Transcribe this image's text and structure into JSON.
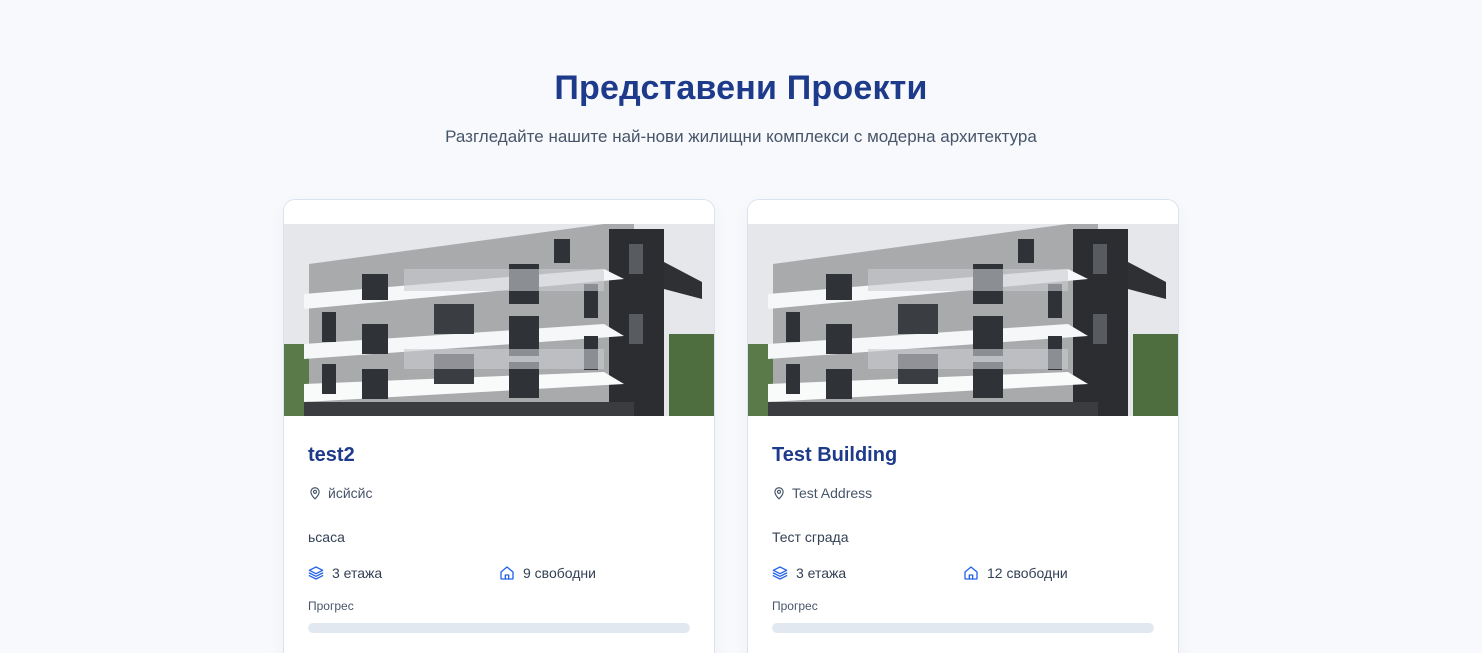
{
  "section": {
    "title": "Представени Проекти",
    "subtitle": "Разгледайте нашите най-нови жилищни комплекси с модерна архитектура"
  },
  "projects": [
    {
      "name": "test2",
      "address": "йсйсйс",
      "description": "ьсаса",
      "floors_label": "3 етажа",
      "available_label": "9 свободни",
      "progress_label": "Прогрес",
      "progress": 0
    },
    {
      "name": "Test Building",
      "address": "Test Address",
      "description": "Тест сграда",
      "floors_label": "3 етажа",
      "available_label": "12 свободни",
      "progress_label": "Прогрес",
      "progress": 0
    }
  ],
  "icons": {
    "location": "map-pin-icon",
    "floors": "layers-icon",
    "available": "home-icon"
  },
  "colors": {
    "accent": "#1e3a8a",
    "icon_blue": "#2563eb",
    "background": "#f7f9fc",
    "progress_track": "#e2e8f0"
  }
}
